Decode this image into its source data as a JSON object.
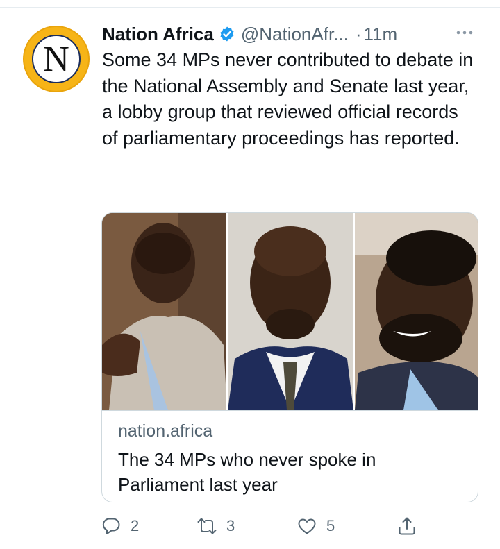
{
  "tweet": {
    "display_name": "Nation Africa",
    "handle": "@NationAfr...",
    "separator": "·",
    "time": "11m",
    "avatar_letter": "N",
    "text": "Some 34 MPs never contributed to debate in the National Assembly and Senate last year, a lobby group that reviewed official records of parliamentary proceedings has reported."
  },
  "card": {
    "domain": "nation.africa",
    "title": "The 34 MPs who never spoke in Parliament last year"
  },
  "actions": {
    "reply_count": "2",
    "retweet_count": "3",
    "like_count": "5"
  },
  "icons": {
    "verified": "verified-badge-icon",
    "more": "more-dots-icon",
    "reply": "reply-icon",
    "retweet": "retweet-icon",
    "like": "heart-icon",
    "share": "share-icon"
  },
  "colors": {
    "verified_blue": "#1d9bf0",
    "avatar_yellow": "#f6b417",
    "muted_text": "#536471",
    "text": "#0f1419"
  }
}
